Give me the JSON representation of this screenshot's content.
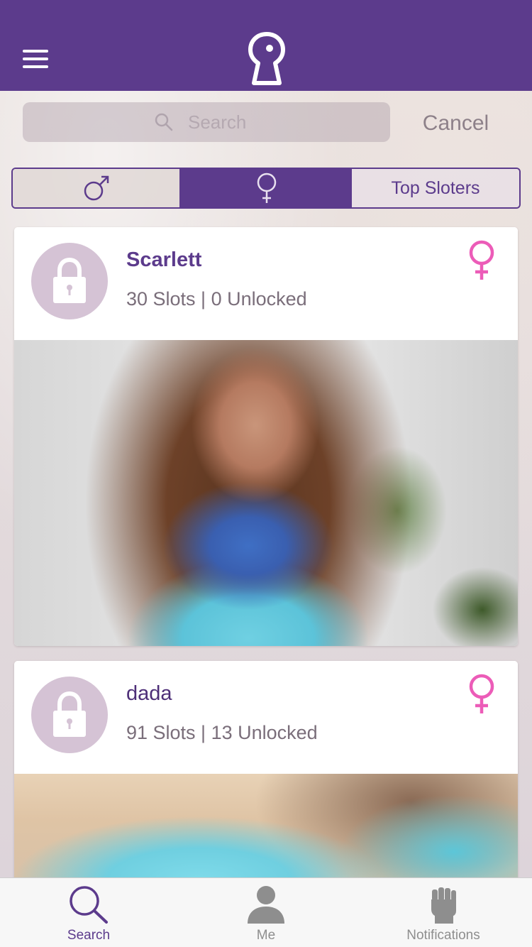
{
  "header": {
    "menu_icon": "hamburger-icon",
    "logo_icon": "keyhole-logo-icon",
    "color": "#5c3b8c"
  },
  "search": {
    "placeholder": "Search",
    "cancel_label": "Cancel"
  },
  "filter": {
    "segments": [
      {
        "icon": "male-symbol-icon",
        "selected": false
      },
      {
        "icon": "female-symbol-icon",
        "selected": true
      },
      {
        "label": "Top Sloters",
        "selected": false
      }
    ]
  },
  "profiles": [
    {
      "name": "Scarlett",
      "stats": "30 Slots | 0 Unlocked",
      "gender_icon": "female-symbol-icon",
      "avatar_icon": "padlock-icon"
    },
    {
      "name": "dada",
      "stats": "91 Slots | 13 Unlocked",
      "gender_icon": "female-symbol-icon",
      "avatar_icon": "padlock-icon"
    }
  ],
  "tabbar": {
    "tabs": [
      {
        "label": "Search",
        "icon": "search-icon",
        "active": true
      },
      {
        "label": "Me",
        "icon": "person-icon",
        "active": false
      },
      {
        "label": "Notifications",
        "icon": "fist-icon",
        "active": false
      }
    ]
  },
  "colors": {
    "accent": "#5c3b8c",
    "gender_female": "#ec5cb8",
    "avatar_bg": "#d5c3d5"
  }
}
